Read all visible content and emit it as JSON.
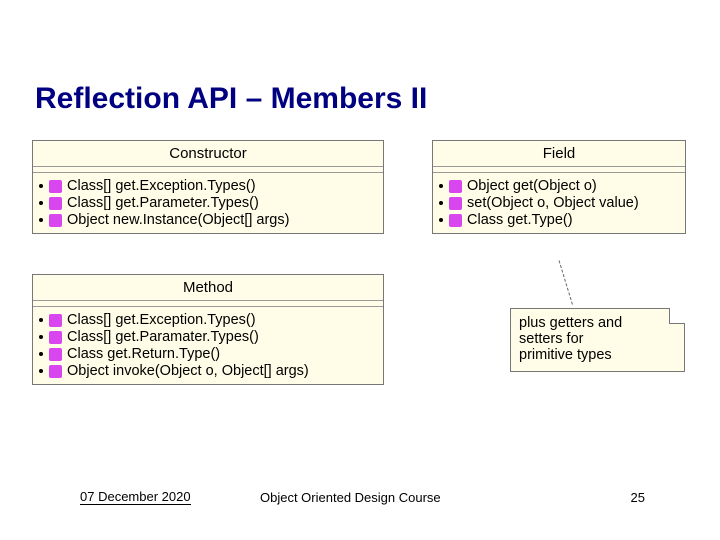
{
  "title": "Reflection API – Members II",
  "classes": {
    "constructor": {
      "name": "Constructor",
      "ops": [
        "Class[] get.Exception.Types()",
        "Class[] get.Parameter.Types()",
        "Object new.Instance(Object[] args)"
      ]
    },
    "field": {
      "name": "Field",
      "ops": [
        "Object get(Object o)",
        "set(Object o, Object value)",
        "Class get.Type()"
      ]
    },
    "method": {
      "name": "Method",
      "ops": [
        "Class[] get.Exception.Types()",
        "Class[] get.Paramater.Types()",
        "Class get.Return.Type()",
        "Object invoke(Object o, Object[] args)"
      ]
    }
  },
  "note": {
    "line1": "plus getters and",
    "line2": "setters for",
    "line3": "primitive types"
  },
  "footer": {
    "date": "07 December 2020",
    "course": "Object Oriented Design Course",
    "page": "25"
  }
}
